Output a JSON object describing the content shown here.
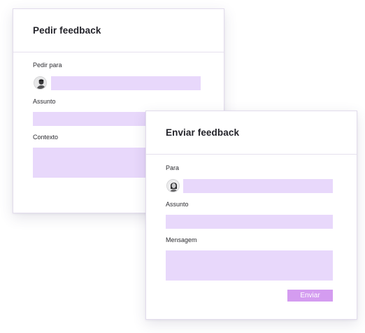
{
  "request_card": {
    "title": "Pedir feedback",
    "to_label": "Pedir para",
    "subject_label": "Assunto",
    "context_label": "Contexto",
    "to_value": "",
    "subject_value": "",
    "context_value": ""
  },
  "send_card": {
    "title": "Enviar feedback",
    "to_label": "Para",
    "subject_label": "Assunto",
    "message_label": "Mensagem",
    "to_value": "",
    "subject_value": "",
    "message_value": "",
    "send_label": "Enviar"
  },
  "colors": {
    "field_fill": "#e8d8fb",
    "button_fill": "#d49cf0",
    "card_border": "#e2dcec"
  },
  "icons": {
    "request_avatar": "user-avatar-icon",
    "send_avatar": "user-avatar-icon"
  }
}
